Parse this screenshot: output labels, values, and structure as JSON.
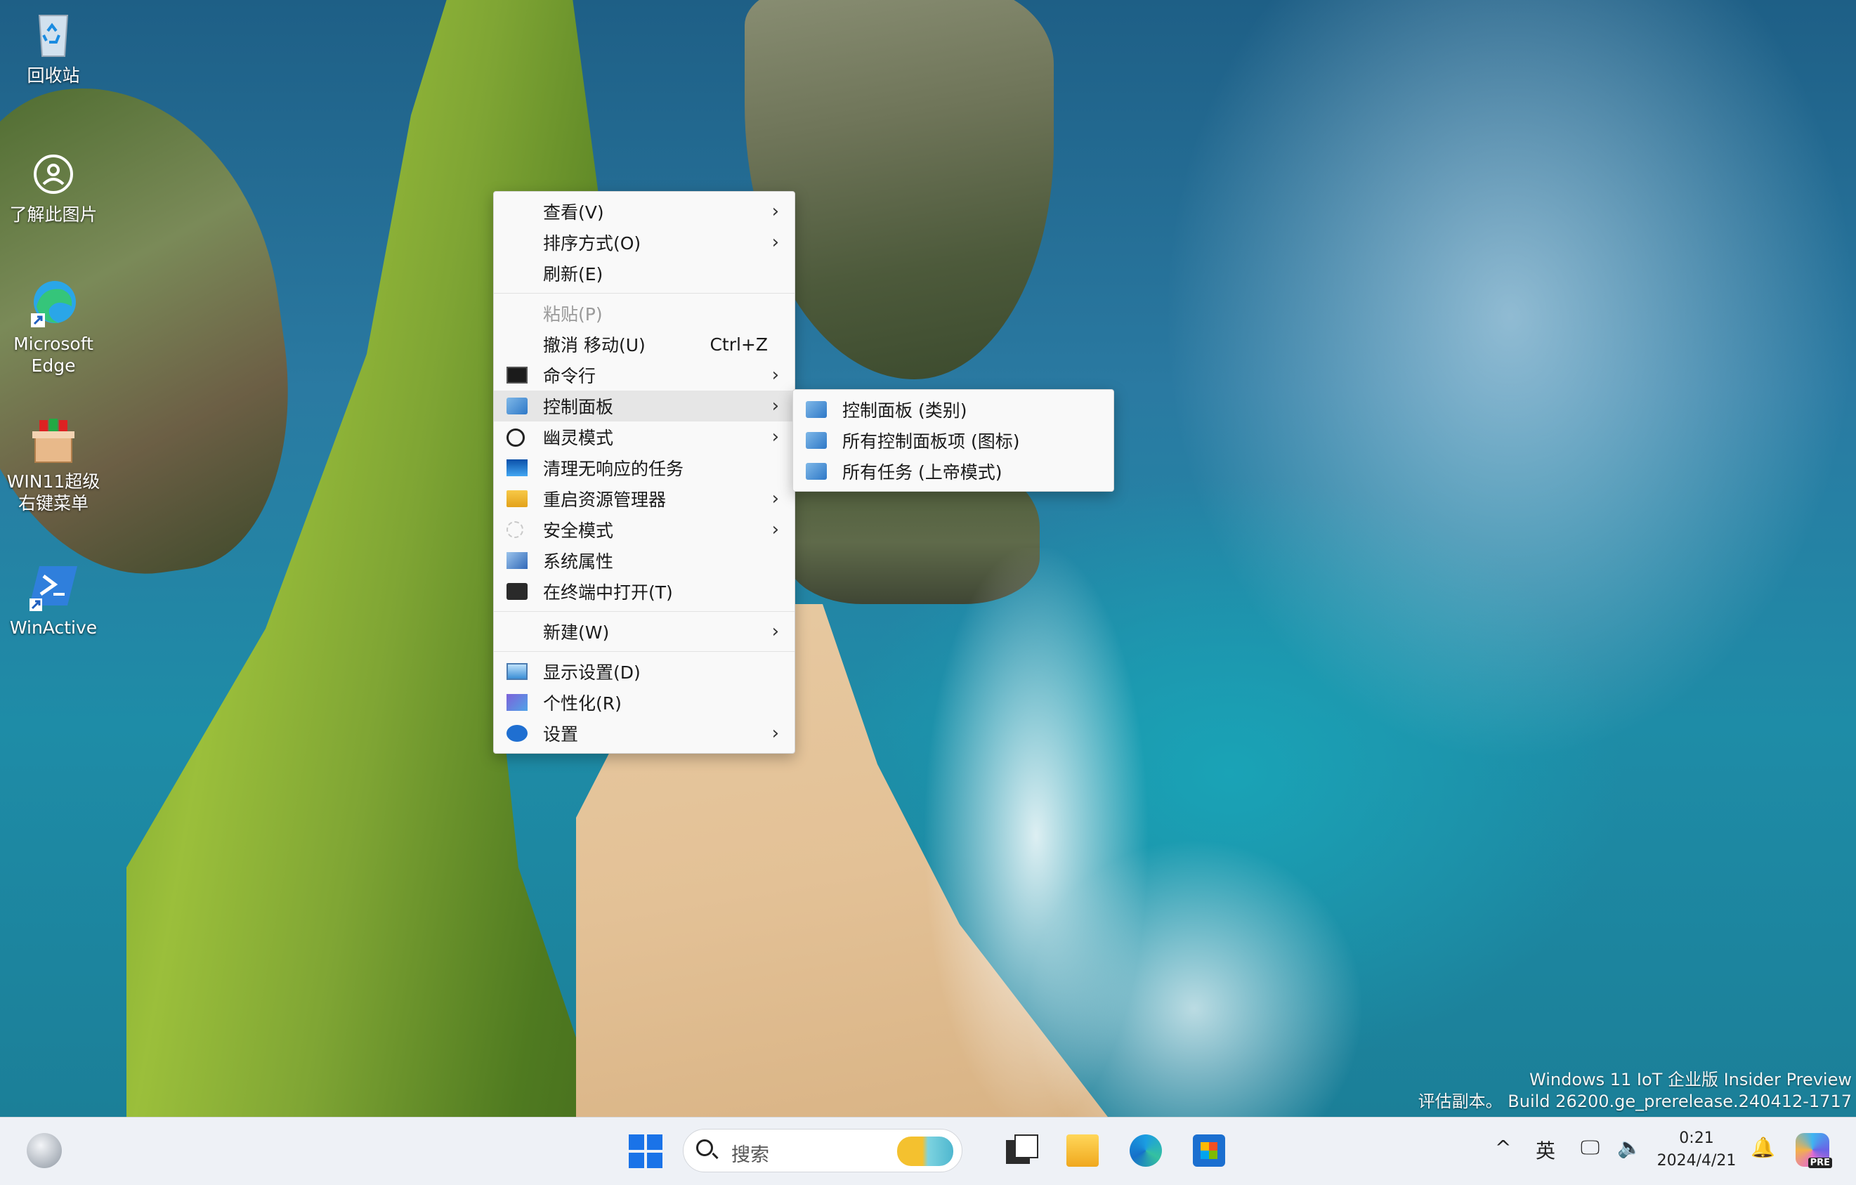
{
  "desktop": {
    "icons": [
      {
        "name": "recycle-bin",
        "label": "回收站"
      },
      {
        "name": "learn-about-picture",
        "label": "了解此图片"
      },
      {
        "name": "edge",
        "label": "Microsoft Edge"
      },
      {
        "name": "win11-menu",
        "label": "WIN11超级右键菜单"
      },
      {
        "name": "winactive",
        "label": "WinActive"
      }
    ],
    "watermark_line1": "Windows 11 IoT 企业版 Insider Preview",
    "watermark_line2": "评估副本。 Build 26200.ge_prerelease.240412-1717"
  },
  "context_menu": {
    "items": [
      {
        "label": "查看(V)",
        "has_submenu": true
      },
      {
        "label": "排序方式(O)",
        "has_submenu": true
      },
      {
        "label": "刷新(E)"
      },
      {
        "label": "粘贴(P)",
        "disabled": true
      },
      {
        "label": "撤消 移动(U)",
        "shortcut": "Ctrl+Z"
      },
      {
        "label": "命令行",
        "icon": "cmd-icon",
        "has_submenu": true
      },
      {
        "label": "控制面板",
        "icon": "control-panel-icon",
        "has_submenu": true,
        "highlighted": true
      },
      {
        "label": "幽灵模式",
        "icon": "ghost-icon",
        "has_submenu": true
      },
      {
        "label": "清理无响应的任务",
        "icon": "cleanup-icon"
      },
      {
        "label": "重启资源管理器",
        "icon": "folder-icon",
        "has_submenu": true
      },
      {
        "label": "安全模式",
        "icon": "safe-mode-icon",
        "has_submenu": true
      },
      {
        "label": "系统属性",
        "icon": "system-properties-icon"
      },
      {
        "label": "在终端中打开(T)",
        "icon": "terminal-icon"
      },
      {
        "label": "新建(W)",
        "has_submenu": true
      },
      {
        "label": "显示设置(D)",
        "icon": "display-icon"
      },
      {
        "label": "个性化(R)",
        "icon": "personalize-icon"
      },
      {
        "label": "设置",
        "icon": "settings-gear-icon",
        "has_submenu": true
      }
    ],
    "arrow": "›"
  },
  "submenu": {
    "items": [
      {
        "label": "控制面板 (类别)"
      },
      {
        "label": "所有控制面板项 (图标)"
      },
      {
        "label": "所有任务 (上帝模式)"
      }
    ]
  },
  "taskbar": {
    "search_placeholder": "搜索",
    "ime": "英",
    "chevron": "^",
    "volume": "🔈",
    "network": "🖵",
    "notify": "🔔",
    "time": "0:21",
    "date": "2024/4/21",
    "copilot_badge": "PRE"
  }
}
